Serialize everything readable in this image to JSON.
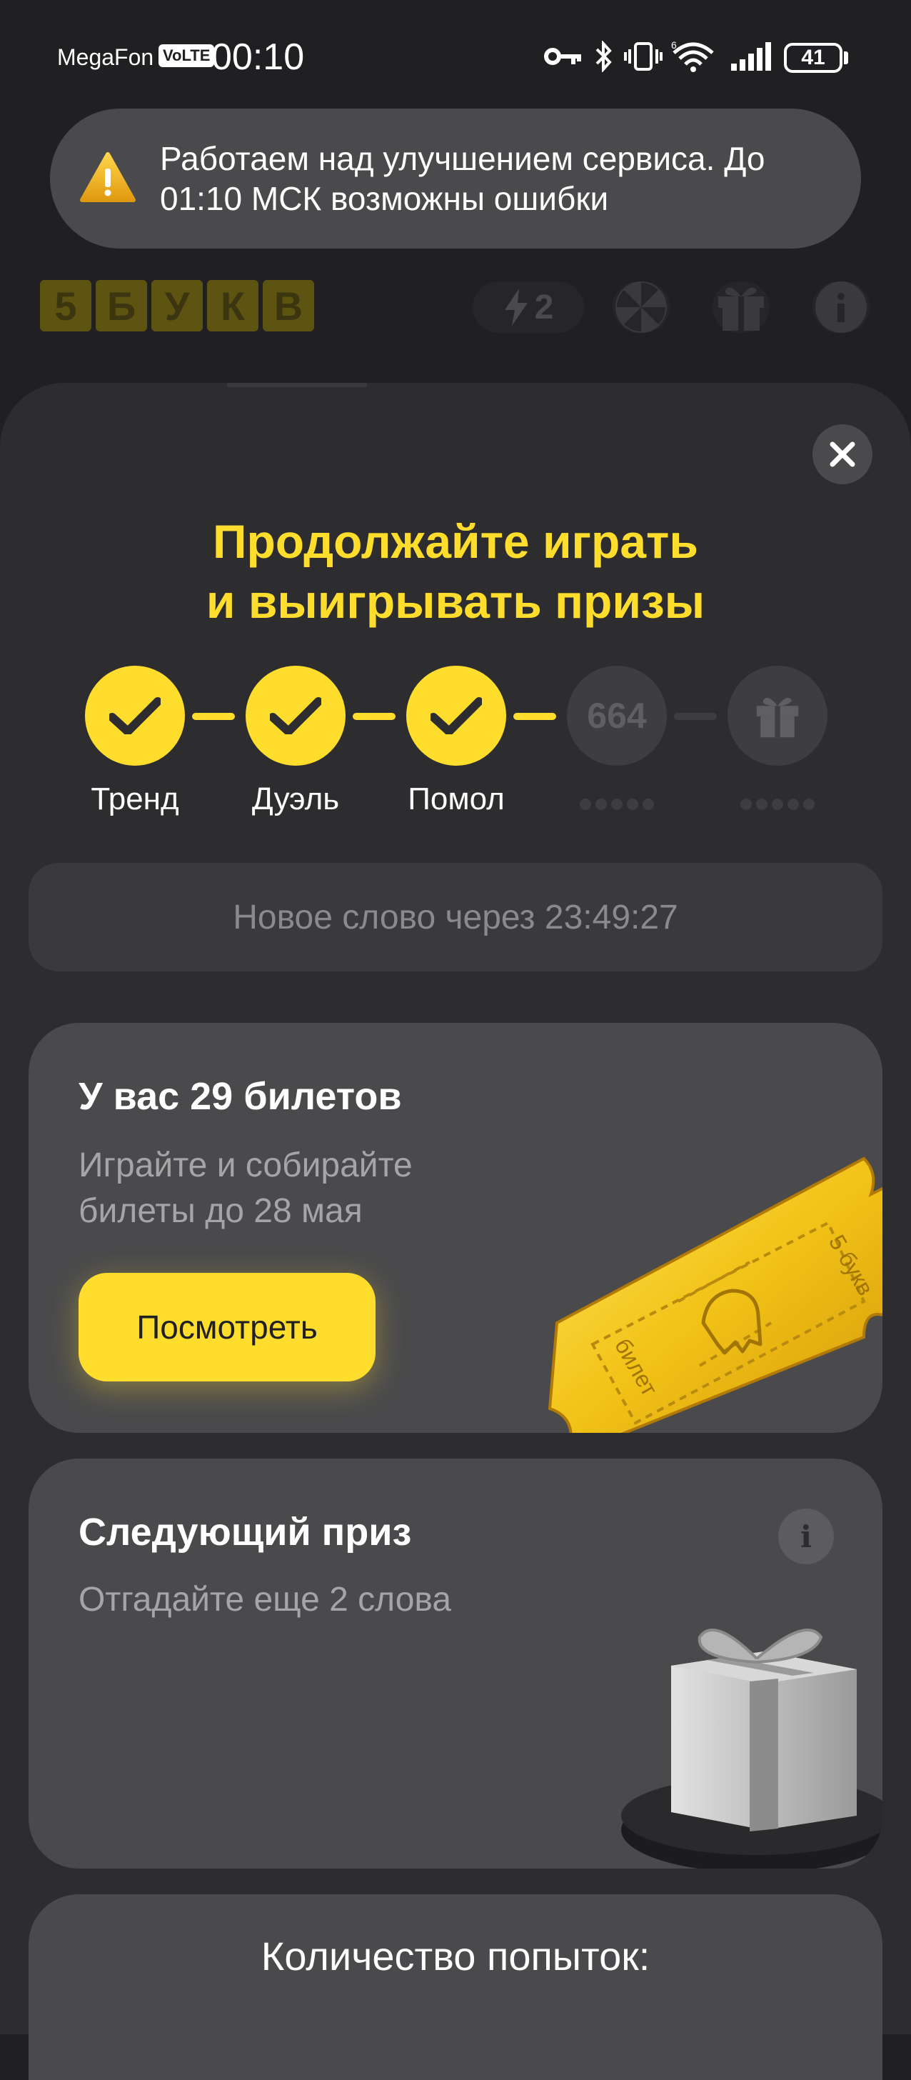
{
  "status_bar": {
    "carrier": "MegaFon",
    "volte": "VoLTE",
    "time": "00:10",
    "battery": "41",
    "icons": [
      "key-icon",
      "bluetooth-icon",
      "vibrate-icon",
      "wifi-6-icon",
      "signal-icon",
      "battery-icon"
    ]
  },
  "toast": {
    "icon": "warning-icon",
    "text": "Работаем над улучшением сервиса. До 01:10 МСК возможны ошибки"
  },
  "header": {
    "logo_letters": [
      "5",
      "Б",
      "У",
      "К",
      "В"
    ],
    "energy_count": "2",
    "icons": [
      "lightning-icon",
      "wheel-icon",
      "gift-icon",
      "info-icon"
    ]
  },
  "sheet": {
    "title_line1": "Продолжайте играть",
    "title_line2": "и выигрывать призы",
    "steps": [
      {
        "label": "Тренд",
        "status": "done"
      },
      {
        "label": "Дуэль",
        "status": "done"
      },
      {
        "label": "Помол",
        "status": "done"
      },
      {
        "label": "664",
        "status": "locked"
      },
      {
        "label": "",
        "status": "locked-gift"
      }
    ],
    "timer_text": "Новое слово через 23:49:27",
    "tickets": {
      "title": "У вас 29 билетов",
      "subtitle_line1": "Играйте и собирайте",
      "subtitle_line2": "билеты до 28 мая",
      "button": "Посмотреть",
      "ticket_text_left": "билет",
      "ticket_text_right": "5 букв"
    },
    "next_prize": {
      "title": "Следующий приз",
      "subtitle": "Отгадайте еще 2 слова"
    },
    "attempts": {
      "title": "Количество попыток:"
    }
  },
  "colors": {
    "accent": "#ffdd2d",
    "background": "#202022",
    "sheet": "#2d2d2f",
    "card": "#4a4a4c"
  }
}
